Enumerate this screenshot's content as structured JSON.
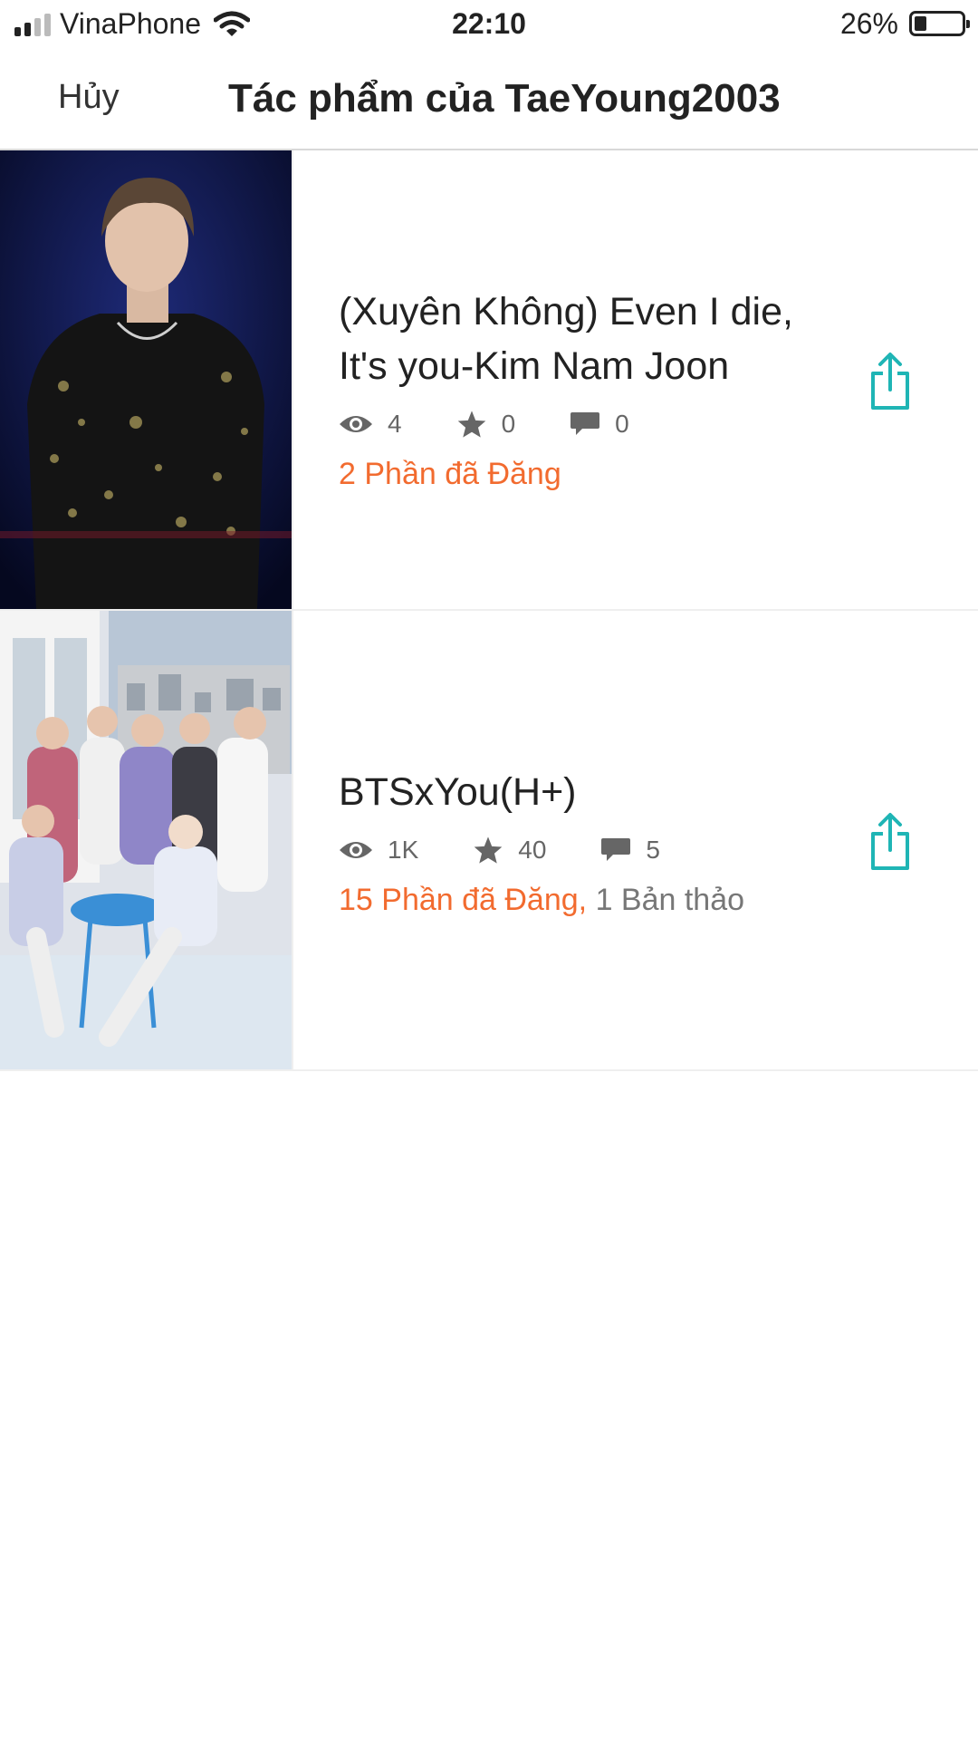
{
  "status_bar": {
    "carrier": "VinaPhone",
    "time": "22:10",
    "battery_percent": "26%",
    "battery_level": 0.26,
    "signal_bars": 2,
    "icons": [
      "signal-icon",
      "wifi-icon",
      "battery-icon"
    ]
  },
  "nav": {
    "cancel_label": "Hủy",
    "title": "Tác phẩm của TaeYoung2003"
  },
  "colors": {
    "published": "#f26b2f",
    "share_icon": "#1fb5b5",
    "stat_icon": "#666666"
  },
  "stories": [
    {
      "title": "(Xuyên Không) Even I die, It's you-Kim Nam Joon",
      "reads": "4",
      "votes": "0",
      "comments": "0",
      "published": "2 Phần đã Đăng",
      "drafts": ""
    },
    {
      "title": "BTSxYou(H+)",
      "reads": "1K",
      "votes": "40",
      "comments": "5",
      "published": "15 Phần đã Đăng,",
      "drafts": "1 Bản thảo"
    }
  ]
}
